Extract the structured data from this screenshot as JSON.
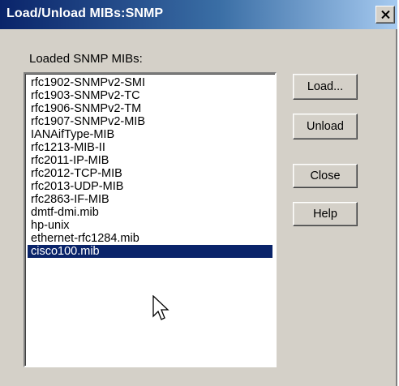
{
  "window": {
    "title": "Load/Unload MIBs:SNMP",
    "close_symbol": "X"
  },
  "list": {
    "label": "Loaded SNMP MIBs:",
    "items": [
      "rfc1902-SNMPv2-SMI",
      "rfc1903-SNMPv2-TC",
      "rfc1906-SNMPv2-TM",
      "rfc1907-SNMPv2-MIB",
      "IANAifType-MIB",
      "rfc1213-MIB-II",
      "rfc2011-IP-MIB",
      "rfc2012-TCP-MIB",
      "rfc2013-UDP-MIB",
      "rfc2863-IF-MIB",
      "dmtf-dmi.mib",
      "hp-unix",
      "ethernet-rfc1284.mib",
      "cisco100.mib"
    ],
    "selected_item": "cisco100.mib"
  },
  "buttons": {
    "load": "Load...",
    "unload": "Unload",
    "close": "Close",
    "help": "Help"
  },
  "icons": {
    "close": "close-icon",
    "cursor": "mouse-pointer-icon"
  },
  "colors": {
    "title_bar_start": "#0a246a",
    "title_bar_end": "#a6caf0",
    "selection": "#0a246a",
    "face": "#d4d0c8"
  }
}
